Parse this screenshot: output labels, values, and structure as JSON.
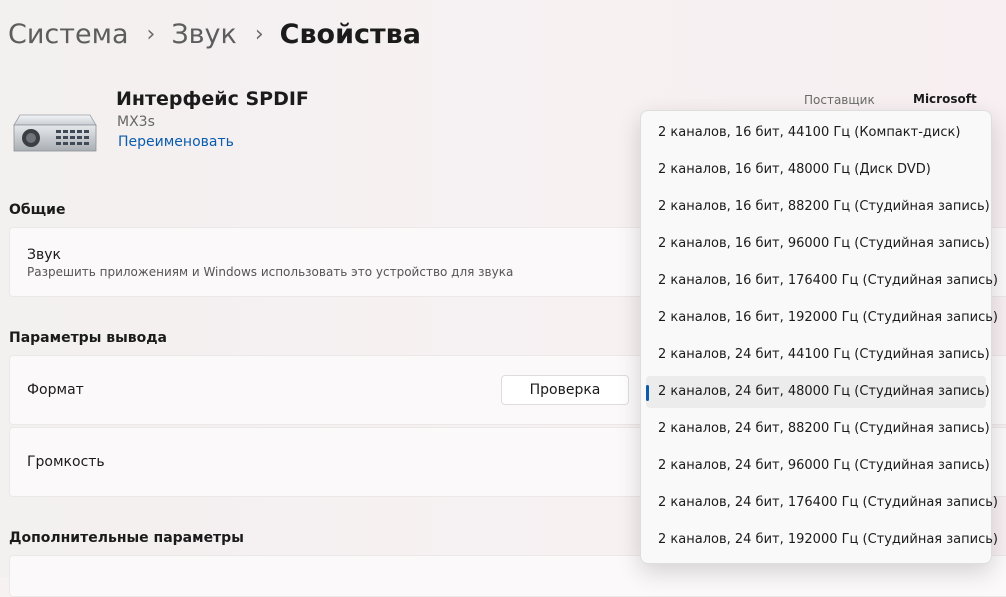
{
  "breadcrumb": {
    "items": [
      "Система",
      "Звук",
      "Свойства"
    ],
    "separator": "›"
  },
  "device": {
    "title": "Интерфейс SPDIF",
    "model": "MX3s",
    "rename_link": "Переименовать",
    "icon": "sound-device-icon",
    "properties": {
      "vendor_label": "Поставщик",
      "vendor_value": "Microsoft"
    }
  },
  "general": {
    "section_title": "Общие",
    "audio": {
      "title": "Звук",
      "subtitle": "Разрешить приложениям и Windows использовать это устройство для звука"
    }
  },
  "output": {
    "section_title": "Параметры вывода",
    "format": {
      "label": "Формат",
      "test_button": "Проверка"
    },
    "volume": {
      "label": "Громкость"
    }
  },
  "advanced": {
    "section_title": "Дополнительные параметры"
  },
  "format_dropdown": {
    "selected_index": 7,
    "options": [
      "2 каналов, 16 бит, 44100 Гц (Компакт-диск)",
      "2 каналов, 16 бит, 48000 Гц (Диск DVD)",
      "2 каналов, 16 бит, 88200 Гц (Студийная запись)",
      "2 каналов, 16 бит, 96000 Гц (Студийная запись)",
      "2 каналов, 16 бит, 176400 Гц (Студийная запись)",
      "2 каналов, 16 бит, 192000 Гц (Студийная запись)",
      "2 каналов, 24 бит, 44100 Гц (Студийная запись)",
      "2 каналов, 24 бит, 48000 Гц (Студийная запись)",
      "2 каналов, 24 бит, 88200 Гц (Студийная запись)",
      "2 каналов, 24 бит, 96000 Гц (Студийная запись)",
      "2 каналов, 24 бит, 176400 Гц (Студийная запись)",
      "2 каналов, 24 бит, 192000 Гц (Студийная запись)"
    ]
  },
  "colors": {
    "accent": "#0b5cad",
    "background": "#f6f2f2",
    "card": "#fbf9f9"
  }
}
